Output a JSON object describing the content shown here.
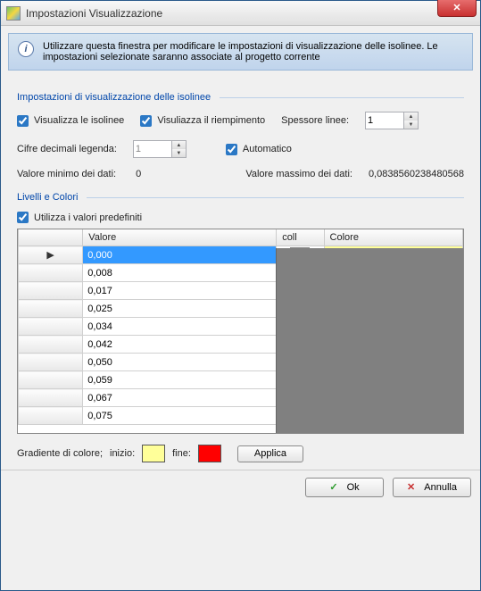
{
  "window": {
    "title": "Impostazioni Visualizzazione"
  },
  "banner": {
    "text": "Utilizzare questa finestra per modificare le impostazioni di visualizzazione delle isolinee. Le impostazioni selezionate saranno associate al progetto corrente"
  },
  "section1": {
    "title": "Impostazioni di visualizzazione delle isolinee",
    "show_isolines_label": "Visualizza le isolinee",
    "show_isolines_checked": true,
    "show_fill_label": "Visuliazza il riempimento",
    "show_fill_checked": true,
    "thickness_label": "Spessore linee:",
    "thickness_value": "1",
    "decimals_label": "Cifre decimali legenda:",
    "decimals_value": "1",
    "auto_label": "Automatico",
    "auto_checked": true,
    "min_label": "Valore minimo dei dati:",
    "min_value": "0",
    "max_label": "Valore massimo dei dati:",
    "max_value": "0,0838560238480568"
  },
  "section2": {
    "title": "Livelli e Colori",
    "defaults_label": "Utilizza i valori predefiniti",
    "defaults_checked": true
  },
  "table": {
    "headers": {
      "value": "Valore",
      "coll": "coll",
      "color": "Colore"
    },
    "rows": [
      {
        "value": "0,000",
        "color": "#ffff99",
        "selected": true,
        "marker": "▶"
      },
      {
        "value": "0,008",
        "color": "#ffef7a"
      },
      {
        "value": "0,017",
        "color": "#ffd95c"
      },
      {
        "value": "0,025",
        "color": "#ffbd3f"
      },
      {
        "value": "0,034",
        "color": "#ffa22e"
      },
      {
        "value": "0,042",
        "color": "#ff8822"
      },
      {
        "value": "0,050",
        "color": "#ff6d18"
      },
      {
        "value": "0,059",
        "color": "#ff4d0e"
      },
      {
        "value": "0,067",
        "color": "#ff2a07"
      },
      {
        "value": "0,075",
        "color": "#ff0000"
      }
    ]
  },
  "gradient": {
    "label": "Gradiente di colore;",
    "start_label": "inizio:",
    "start_color": "#ffff99",
    "end_label": "fine:",
    "end_color": "#ff0000",
    "apply_label": "Applica"
  },
  "footer": {
    "ok_label": "Ok",
    "cancel_label": "Annulla"
  }
}
